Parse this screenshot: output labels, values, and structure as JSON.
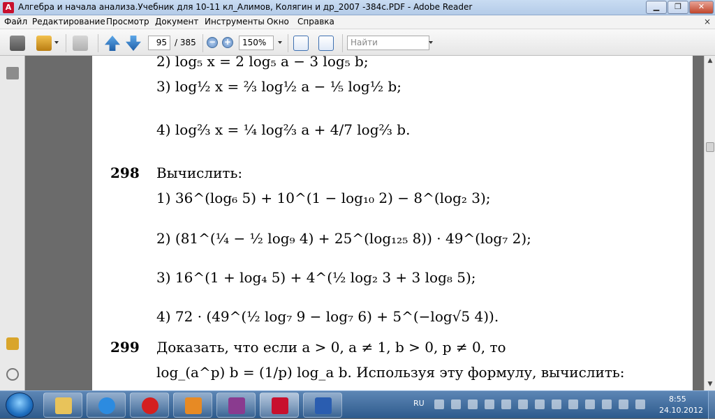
{
  "window": {
    "title": "Алгебра и начала анализа.Учебник для 10-11 кл_Алимов, Колягин и др_2007 -384с.PDF - Adobe Reader",
    "minimize": "▁",
    "maximize": "❐",
    "close": "✕"
  },
  "menu": {
    "items": [
      "Файл",
      "Редактирование",
      "Просмотр",
      "Документ",
      "Инструменты",
      "Окно",
      "Справка"
    ],
    "close_x": "×"
  },
  "toolbar": {
    "page_current": "95",
    "page_total": "/ 385",
    "zoom": "150%",
    "zoom_out": "−",
    "zoom_in": "+",
    "search_placeholder": "Найти"
  },
  "document": {
    "lines": [
      "2)  log₅ x = 2 log₅ a − 3 log₅ b;",
      "3)  log½ x = ⅔ log½ a − ⅕ log½ b;",
      "4)  log⅔ x = ¼ log⅔ a + 4/7 log⅔ b.",
      "298",
      "Вычислить:",
      "1)  36^(log₆ 5) + 10^(1 − log₁₀ 2) − 8^(log₂ 3);",
      "2)  (81^(¼ − ½ log₉ 4) + 25^(log₁₂₅ 8)) · 49^(log₇ 2);",
      "3)  16^(1 + log₄ 5) + 4^(½ log₂ 3 + 3 log₈ 5);",
      "4)  72 · (49^(½ log₇ 9 − log₇ 6) + 5^(−log√5 4)).",
      "299",
      "Доказать, что если a > 0, a ≠ 1, b > 0, p ≠ 0, то",
      "log_(a^p) b = (1/p) log_a b.  Используя эту формулу, вычислить:"
    ]
  },
  "taskbar": {
    "lang": "RU",
    "time": "8:55",
    "date": "24.10.2012"
  },
  "colors": {
    "taskbar": "#2d5a8c",
    "titlebar": "#b4cbe8",
    "adobe_red": "#c8102e"
  }
}
